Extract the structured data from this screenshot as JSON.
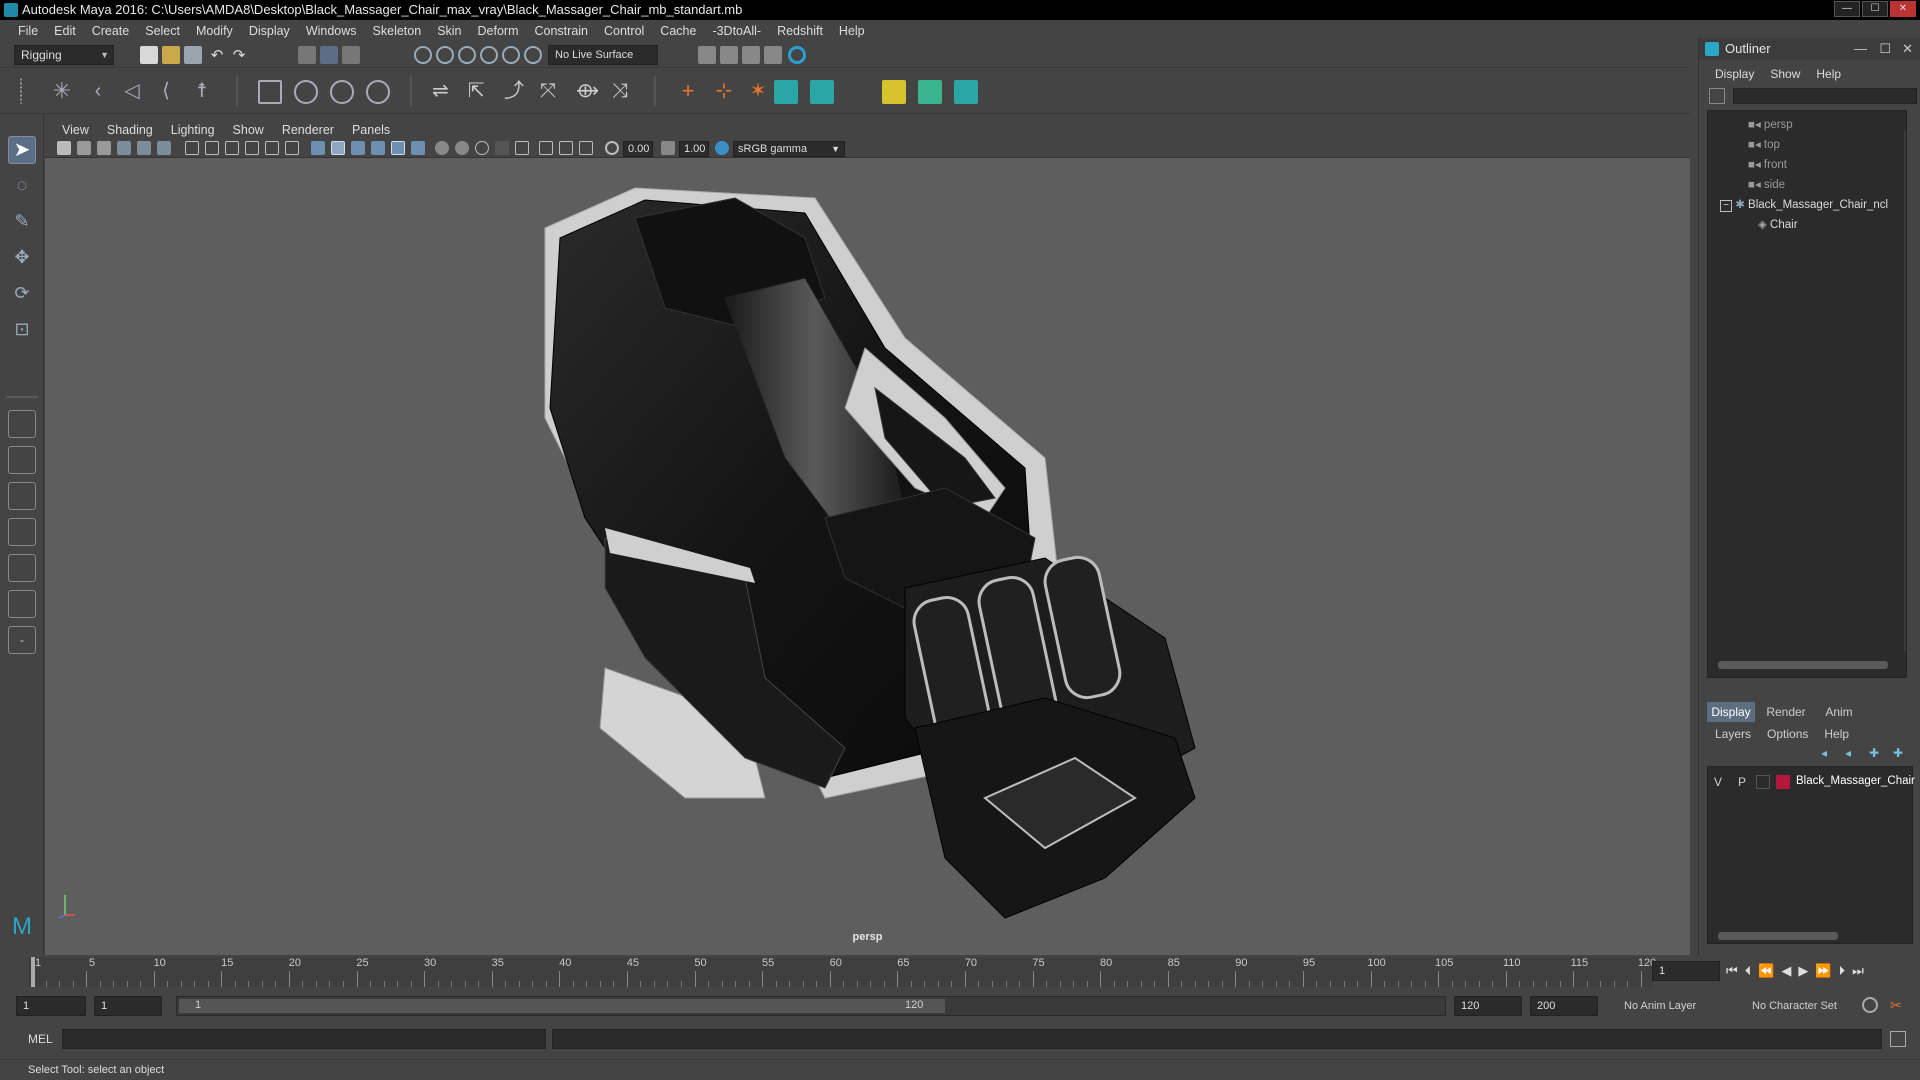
{
  "window": {
    "title": "Autodesk Maya 2016: C:\\Users\\AMDA8\\Desktop\\Black_Massager_Chair_max_vray\\Black_Massager_Chair_mb_standart.mb",
    "minimize": "—",
    "maximize": "☐",
    "close": "✕"
  },
  "menubar": [
    "File",
    "Edit",
    "Create",
    "Select",
    "Modify",
    "Display",
    "Windows",
    "Skeleton",
    "Skin",
    "Deform",
    "Constrain",
    "Control",
    "Cache",
    "-3DtoAll-",
    "Redshift",
    "Help"
  ],
  "status_line": {
    "menu_set": "Rigging",
    "live_surface": "No Live Surface"
  },
  "viewport": {
    "menu": [
      "View",
      "Shading",
      "Lighting",
      "Show",
      "Renderer",
      "Panels"
    ],
    "exposure": "0.00",
    "gamma": "1.00",
    "color_space": "sRGB gamma",
    "camera_label": "persp"
  },
  "outliner": {
    "title": "Outliner",
    "menu": [
      "Display",
      "Show",
      "Help"
    ],
    "items": [
      {
        "label": "persp",
        "kind": "camera"
      },
      {
        "label": "top",
        "kind": "camera"
      },
      {
        "label": "front",
        "kind": "camera"
      },
      {
        "label": "side",
        "kind": "camera"
      },
      {
        "label": "Black_Massager_Chair_ncl",
        "kind": "group",
        "expand": "−"
      },
      {
        "label": "Chair",
        "kind": "mesh"
      }
    ]
  },
  "layer_editor": {
    "tabs": [
      "Display",
      "Render",
      "Anim"
    ],
    "menu": [
      "Layers",
      "Options",
      "Help"
    ],
    "layers": [
      {
        "visible": "V",
        "playback": "P",
        "name": "Black_Massager_Chair",
        "color": "#b3183c"
      }
    ]
  },
  "time_slider": {
    "ticks": [
      "1",
      "5",
      "10",
      "15",
      "20",
      "25",
      "30",
      "35",
      "40",
      "45",
      "50",
      "55",
      "60",
      "65",
      "70",
      "75",
      "80",
      "85",
      "90",
      "95",
      "100",
      "105",
      "110",
      "115",
      "120"
    ],
    "current_frame": "1"
  },
  "range_slider": {
    "start_frame": "1",
    "playback_start": "1",
    "range_start_label": "1",
    "range_end_label": "120",
    "playback_end": "120",
    "end_frame": "200",
    "anim_layer": "No Anim Layer",
    "character_set": "No Character Set"
  },
  "command_line": {
    "language": "MEL"
  },
  "help_line": "Select Tool: select an object",
  "colors": {
    "ui_bg": "#444444",
    "viewport_bg": "#5e5e5e",
    "field_bg": "#2b2b2b",
    "accent": "#5a6f85",
    "layer_color": "#b3183c"
  }
}
